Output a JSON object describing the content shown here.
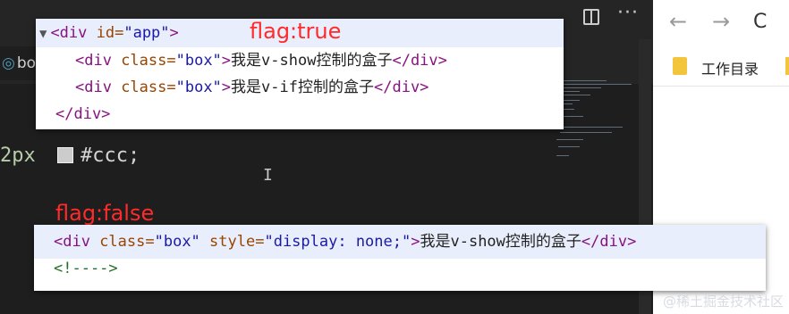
{
  "editor": {
    "tab_fragment": "bo",
    "code_px": "2px",
    "code_color_value": "#ccc;",
    "cursor_glyph": "I"
  },
  "browser": {
    "back_glyph": "←",
    "forward_glyph": "→",
    "reload_glyph": "C",
    "bookmark_folder": "工作目录"
  },
  "flags": {
    "true_label": "flag:true",
    "false_label": "flag:false"
  },
  "panel_true": {
    "line1": {
      "tag_open": "<div ",
      "attr": "id=",
      "val": "\"app\"",
      "tag_close": ">"
    },
    "line2": {
      "tag_open": "<div ",
      "attr": "class=",
      "val": "\"box\"",
      "tag_close": ">",
      "text": "我是v-show控制的盒子",
      "end_tag": "</div>"
    },
    "line3": {
      "tag_open": "<div ",
      "attr": "class=",
      "val": "\"box\"",
      "tag_close": ">",
      "text": "我是v-if控制的盒子",
      "end_tag": "</div>"
    },
    "line4": {
      "end_tag": "</div>"
    }
  },
  "panel_false": {
    "line1": {
      "tag_open": "<div ",
      "attr1": "class=",
      "val1": "\"box\"",
      "space": " ",
      "attr2": "style=",
      "val2": "\"display: none;\"",
      "tag_close": ">",
      "text": "我是v-show控制的盒子",
      "end_tag": "</div>"
    },
    "line2": {
      "comment": "<!---->"
    }
  },
  "watermark": "@稀土掘金技术社区",
  "colors": {
    "editor_bg": "#1e1e1e",
    "flag_red": "#ff2a2a",
    "tag_purple": "#881280",
    "attr_brown": "#994500",
    "value_blue": "#1a1aa6",
    "highlight": "#e8eefb"
  }
}
